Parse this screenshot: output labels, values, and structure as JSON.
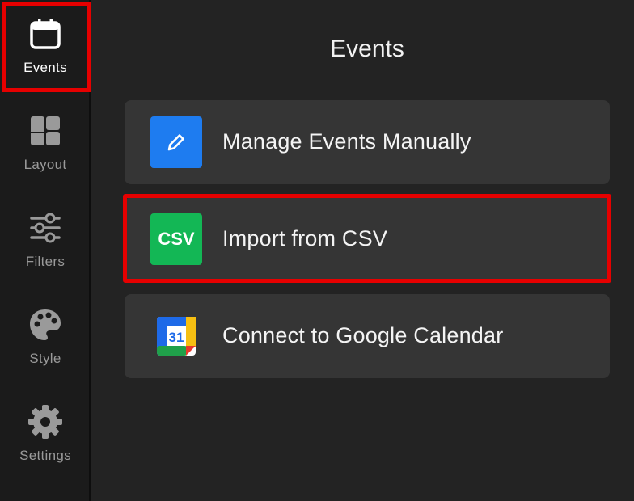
{
  "sidebar": {
    "items": [
      {
        "label": "Events",
        "icon": "calendar-icon",
        "active": true
      },
      {
        "label": "Layout",
        "icon": "layout-grid-icon"
      },
      {
        "label": "Filters",
        "icon": "sliders-icon"
      },
      {
        "label": "Style",
        "icon": "palette-icon"
      },
      {
        "label": "Settings",
        "icon": "gear-icon"
      }
    ]
  },
  "main": {
    "title": "Events",
    "options": [
      {
        "label": "Manage Events Manually",
        "icon": "pencil-icon",
        "icon_color": "#1e7cf0"
      },
      {
        "label": "Import from CSV",
        "icon": "csv-icon",
        "icon_text": "CSV",
        "icon_color": "#13b755"
      },
      {
        "label": "Connect to Google Calendar",
        "icon": "google-calendar-icon",
        "icon_text": "31"
      }
    ]
  },
  "colors": {
    "highlight": "#e60000",
    "background": "#232323",
    "sidebar": "#1b1b1b",
    "card": "#353535"
  }
}
